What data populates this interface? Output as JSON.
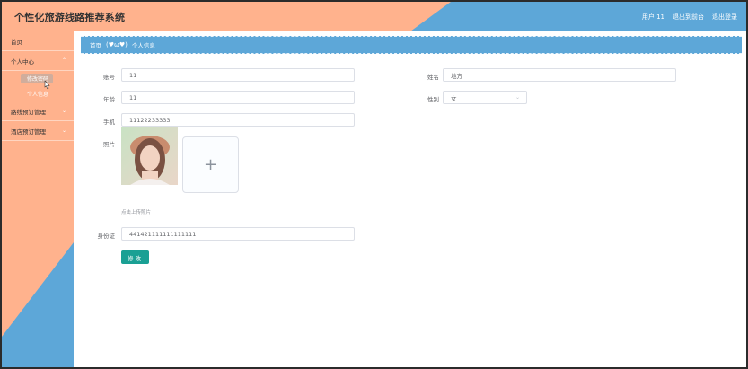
{
  "header": {
    "title": "个性化旅游线路推荐系统",
    "user_label": "用户 11",
    "back_label": "退出到前台",
    "logout_label": "退出登录"
  },
  "sidebar": {
    "items": [
      {
        "label": "首页"
      },
      {
        "label": "个人中心",
        "chevron": "⌃"
      },
      {
        "label": "路线预订管理",
        "chevron": "⌄"
      },
      {
        "label": "酒店预订管理",
        "chevron": "⌄"
      }
    ],
    "sub_items": [
      {
        "label": "修改密码"
      },
      {
        "label": "个人信息"
      }
    ]
  },
  "breadcrumb": {
    "home": "首页",
    "decoration": "(♥ω♥)",
    "current": "个人信息"
  },
  "form": {
    "account_label": "账号",
    "account_value": "11",
    "name_label": "姓名",
    "name_value": "地方",
    "age_label": "年龄",
    "age_value": "11",
    "gender_label": "性别",
    "gender_value": "女",
    "phone_label": "手机",
    "phone_value": "11122233333",
    "photo_label": "照片",
    "upload_plus": "+",
    "upload_hint": "点击上传照片",
    "idcard_label": "身份证",
    "idcard_value": "441421111111111111",
    "submit_label": "修改"
  },
  "colors": {
    "peach": "#ffb28d",
    "blue": "#5da7d8",
    "button": "#1aa094"
  }
}
